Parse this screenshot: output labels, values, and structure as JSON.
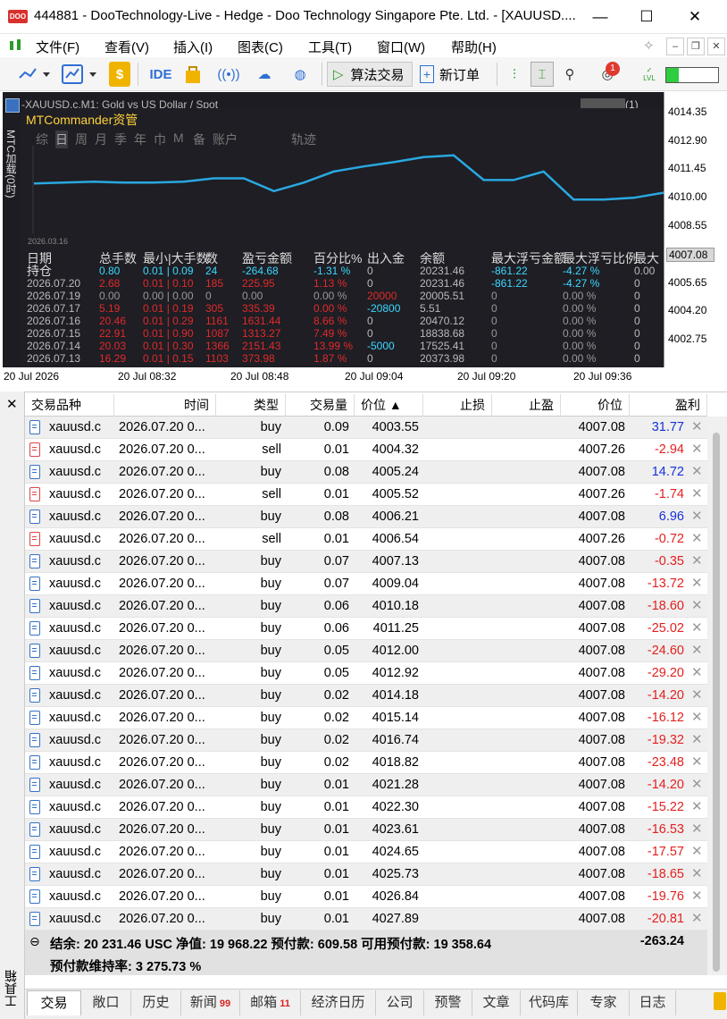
{
  "window": {
    "title": "444881 - DooTechnology-Live - Hedge - Doo Technology Singapore Pte. Ltd. - [XAUUSD....",
    "logo": "DOO",
    "min": "—",
    "max": "☐",
    "close": "✕"
  },
  "menu": [
    "文件(F)",
    "查看(V)",
    "插入(I)",
    "图表(C)",
    "工具(T)",
    "窗口(W)",
    "帮助(H)"
  ],
  "toolbar": {
    "ide": "IDE",
    "algo": "算法交易",
    "new_order": "新订单",
    "notif_count": "1",
    "lvl": "LVL"
  },
  "chart": {
    "symbol_line": "-XAUUSD.c,M1:  Gold vs US Dollar / Spot",
    "price_labels": [
      "4014.35",
      "4012.90",
      "4011.45",
      "4010.00",
      "4008.55",
      "4005.65",
      "4004.20",
      "4002.75"
    ],
    "current_price": "4007.08",
    "time_labels": [
      "20 Jul 2026",
      "20 Jul 08:32",
      "20 Jul 08:48",
      "20 Jul 09:04",
      "20 Jul 09:20",
      "20 Jul 09:36"
    ],
    "overlay_right": "(1)",
    "left_vtext": "MTC加载(0时)",
    "mtc": {
      "title": "MTCommander资管",
      "tabs": [
        "综",
        "日",
        "周",
        "月",
        "季",
        "年",
        "巾",
        "M",
        "备",
        "账户",
        "轨迹"
      ],
      "date_label": "2026.03.16",
      "curve": [
        0.36,
        0.35,
        0.34,
        0.35,
        0.35,
        0.34,
        0.3,
        0.3,
        0.45,
        0.35,
        0.22,
        0.16,
        0.11,
        0.05,
        0.03,
        0.32,
        0.32,
        0.22,
        0.55,
        0.55,
        0.53,
        0.47
      ],
      "headers": [
        "日期",
        "总手数",
        "最小|大手数",
        "数",
        "盈亏金额",
        "百分比%",
        "出入金",
        "余额",
        "最大浮亏金额",
        "最大浮亏比例",
        "最大"
      ],
      "rows": [
        {
          "date": "持仓",
          "lots": "0.80",
          "minmax": "0.01 | 0.09",
          "n": "24",
          "pl": "-264.68",
          "pct": "-1.31 %",
          "io": "0",
          "bal": "20231.46",
          "mfl": "-861.22",
          "mfp": "-4.27 %",
          "last": "0.00",
          "c": "cyan"
        },
        {
          "date": "2026.07.20",
          "lots": "2.68",
          "minmax": "0.01 | 0.10",
          "n": "185",
          "pl": "225.95",
          "pct": "1.13 %",
          "io": "0",
          "bal": "20231.46",
          "mfl": "-861.22",
          "mfp": "-4.27 %",
          "last": "0",
          "c": "red"
        },
        {
          "date": "2026.07.19",
          "lots": "0.00",
          "minmax": "0.00 | 0.00",
          "n": "0",
          "pl": "0.00",
          "pct": "0.00 %",
          "io": "20000",
          "bal": "20005.51",
          "mfl": "0",
          "mfp": "0.00 %",
          "last": "0",
          "c": "gray"
        },
        {
          "date": "2026.07.17",
          "lots": "5.19",
          "minmax": "0.01 | 0.19",
          "n": "305",
          "pl": "335.39",
          "pct": "0.00 %",
          "io": "-20800",
          "bal": "5.51",
          "mfl": "0",
          "mfp": "0.00 %",
          "last": "0",
          "c": "red"
        },
        {
          "date": "2026.07.16",
          "lots": "20.46",
          "minmax": "0.01 | 0.29",
          "n": "1161",
          "pl": "1631.44",
          "pct": "8.66 %",
          "io": "0",
          "bal": "20470.12",
          "mfl": "0",
          "mfp": "0.00 %",
          "last": "0",
          "c": "red"
        },
        {
          "date": "2026.07.15",
          "lots": "22.91",
          "minmax": "0.01 | 0.90",
          "n": "1087",
          "pl": "1313.27",
          "pct": "7.49 %",
          "io": "0",
          "bal": "18838.68",
          "mfl": "0",
          "mfp": "0.00 %",
          "last": "0",
          "c": "red"
        },
        {
          "date": "2026.07.14",
          "lots": "20.03",
          "minmax": "0.01 | 0.30",
          "n": "1366",
          "pl": "2151.43",
          "pct": "13.99 %",
          "io": "-5000",
          "bal": "17525.41",
          "mfl": "0",
          "mfp": "0.00 %",
          "last": "0",
          "c": "red"
        },
        {
          "date": "2026.07.13",
          "lots": "16.29",
          "minmax": "0.01 | 0.15",
          "n": "1103",
          "pl": "373.98",
          "pct": "1.87 %",
          "io": "0",
          "bal": "20373.98",
          "mfl": "0",
          "mfp": "0.00 %",
          "last": "0",
          "c": "red"
        }
      ]
    }
  },
  "terminal": {
    "close": "✕",
    "columns": [
      "交易品种",
      "时间",
      "类型",
      "交易量",
      "价位 ▲",
      "止损",
      "止盈",
      "价位",
      "盈利"
    ],
    "rows": [
      [
        "xauusd.c",
        "2026.07.20 0...",
        "buy",
        "0.09",
        "4003.55",
        "",
        "",
        "4007.08",
        "31.77"
      ],
      [
        "xauusd.c",
        "2026.07.20 0...",
        "sell",
        "0.01",
        "4004.32",
        "",
        "",
        "4007.26",
        "-2.94"
      ],
      [
        "xauusd.c",
        "2026.07.20 0...",
        "buy",
        "0.08",
        "4005.24",
        "",
        "",
        "4007.08",
        "14.72"
      ],
      [
        "xauusd.c",
        "2026.07.20 0...",
        "sell",
        "0.01",
        "4005.52",
        "",
        "",
        "4007.26",
        "-1.74"
      ],
      [
        "xauusd.c",
        "2026.07.20 0...",
        "buy",
        "0.08",
        "4006.21",
        "",
        "",
        "4007.08",
        "6.96"
      ],
      [
        "xauusd.c",
        "2026.07.20 0...",
        "sell",
        "0.01",
        "4006.54",
        "",
        "",
        "4007.26",
        "-0.72"
      ],
      [
        "xauusd.c",
        "2026.07.20 0...",
        "buy",
        "0.07",
        "4007.13",
        "",
        "",
        "4007.08",
        "-0.35"
      ],
      [
        "xauusd.c",
        "2026.07.20 0...",
        "buy",
        "0.07",
        "4009.04",
        "",
        "",
        "4007.08",
        "-13.72"
      ],
      [
        "xauusd.c",
        "2026.07.20 0...",
        "buy",
        "0.06",
        "4010.18",
        "",
        "",
        "4007.08",
        "-18.60"
      ],
      [
        "xauusd.c",
        "2026.07.20 0...",
        "buy",
        "0.06",
        "4011.25",
        "",
        "",
        "4007.08",
        "-25.02"
      ],
      [
        "xauusd.c",
        "2026.07.20 0...",
        "buy",
        "0.05",
        "4012.00",
        "",
        "",
        "4007.08",
        "-24.60"
      ],
      [
        "xauusd.c",
        "2026.07.20 0...",
        "buy",
        "0.05",
        "4012.92",
        "",
        "",
        "4007.08",
        "-29.20"
      ],
      [
        "xauusd.c",
        "2026.07.20 0...",
        "buy",
        "0.02",
        "4014.18",
        "",
        "",
        "4007.08",
        "-14.20"
      ],
      [
        "xauusd.c",
        "2026.07.20 0...",
        "buy",
        "0.02",
        "4015.14",
        "",
        "",
        "4007.08",
        "-16.12"
      ],
      [
        "xauusd.c",
        "2026.07.20 0...",
        "buy",
        "0.02",
        "4016.74",
        "",
        "",
        "4007.08",
        "-19.32"
      ],
      [
        "xauusd.c",
        "2026.07.20 0...",
        "buy",
        "0.02",
        "4018.82",
        "",
        "",
        "4007.08",
        "-23.48"
      ],
      [
        "xauusd.c",
        "2026.07.20 0...",
        "buy",
        "0.01",
        "4021.28",
        "",
        "",
        "4007.08",
        "-14.20"
      ],
      [
        "xauusd.c",
        "2026.07.20 0...",
        "buy",
        "0.01",
        "4022.30",
        "",
        "",
        "4007.08",
        "-15.22"
      ],
      [
        "xauusd.c",
        "2026.07.20 0...",
        "buy",
        "0.01",
        "4023.61",
        "",
        "",
        "4007.08",
        "-16.53"
      ],
      [
        "xauusd.c",
        "2026.07.20 0...",
        "buy",
        "0.01",
        "4024.65",
        "",
        "",
        "4007.08",
        "-17.57"
      ],
      [
        "xauusd.c",
        "2026.07.20 0...",
        "buy",
        "0.01",
        "4025.73",
        "",
        "",
        "4007.08",
        "-18.65"
      ],
      [
        "xauusd.c",
        "2026.07.20 0...",
        "buy",
        "0.01",
        "4026.84",
        "",
        "",
        "4007.08",
        "-19.76"
      ],
      [
        "xauusd.c",
        "2026.07.20 0...",
        "buy",
        "0.01",
        "4027.89",
        "",
        "",
        "4007.08",
        "-20.81"
      ]
    ],
    "summary": {
      "line1": "结余: 20 231.46 USC  净值: 19 968.22  预付款: 609.58  可用预付款: 19 358.64",
      "total": "-263.24",
      "line2": "预付款维持率: 3 275.73 %"
    },
    "side_label": "工具箱",
    "tabs": [
      {
        "label": "交易",
        "badge": ""
      },
      {
        "label": "敞口",
        "badge": ""
      },
      {
        "label": "历史",
        "badge": ""
      },
      {
        "label": "新闻",
        "badge": "99"
      },
      {
        "label": "邮箱",
        "badge": "11"
      },
      {
        "label": "经济日历",
        "badge": ""
      },
      {
        "label": "公司",
        "badge": ""
      },
      {
        "label": "预警",
        "badge": ""
      },
      {
        "label": "文章",
        "badge": ""
      },
      {
        "label": "代码库",
        "badge": ""
      },
      {
        "label": "专家",
        "badge": ""
      },
      {
        "label": "日志",
        "badge": ""
      }
    ]
  },
  "colors": {
    "accent": "#2f6fd4",
    "chart_bg": "#1c1c22",
    "curve": "#29a8e0",
    "neg": "#e32020",
    "pos": "#1730d8"
  }
}
